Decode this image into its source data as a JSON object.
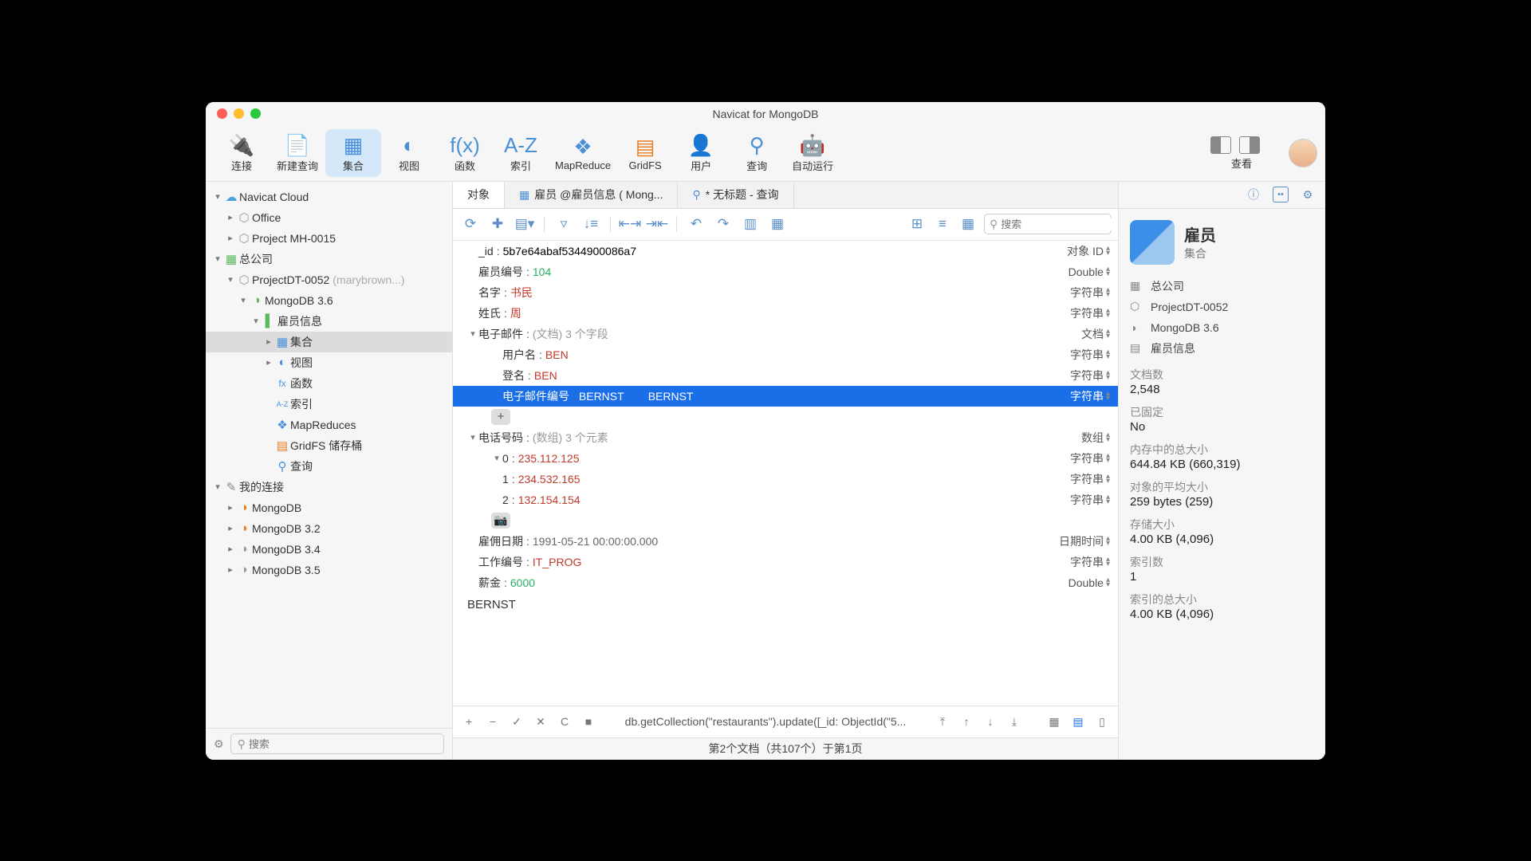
{
  "window": {
    "title": "Navicat for MongoDB"
  },
  "toolbar": {
    "items": [
      {
        "id": "connect",
        "label": "连接"
      },
      {
        "id": "newquery",
        "label": "新建查询"
      },
      {
        "id": "collection",
        "label": "集合",
        "active": true
      },
      {
        "id": "view",
        "label": "视图"
      },
      {
        "id": "function",
        "label": "函数"
      },
      {
        "id": "index",
        "label": "索引"
      },
      {
        "id": "mapreduce",
        "label": "MapReduce"
      },
      {
        "id": "gridfs",
        "label": "GridFS"
      },
      {
        "id": "user",
        "label": "用户"
      },
      {
        "id": "query",
        "label": "查询"
      },
      {
        "id": "autorun",
        "label": "自动运行"
      }
    ],
    "view_label": "查看"
  },
  "sidebar": {
    "search_placeholder": "搜索",
    "nodes": [
      {
        "pad": 8,
        "chev": "▾",
        "icon": "☁",
        "color": "#4aa3e0",
        "label": "Navicat Cloud"
      },
      {
        "pad": 24,
        "chev": "▸",
        "icon": "⬡",
        "color": "#999",
        "label": "Office"
      },
      {
        "pad": 24,
        "chev": "▸",
        "icon": "⬡",
        "color": "#999",
        "label": "Project MH-0015"
      },
      {
        "pad": 8,
        "chev": "▾",
        "icon": "▦",
        "color": "#5cb85c",
        "label": "总公司"
      },
      {
        "pad": 24,
        "chev": "▾",
        "icon": "⬡",
        "color": "#999",
        "label": "ProjectDT-0052",
        "hint": "(marybrown...)"
      },
      {
        "pad": 40,
        "chev": "▾",
        "icon": "◑",
        "color": "#5cb85c",
        "label": "MongoDB 3.6"
      },
      {
        "pad": 56,
        "chev": "▾",
        "icon": "▌",
        "color": "#5cb85c",
        "label": "雇员信息"
      },
      {
        "pad": 72,
        "chev": "▸",
        "icon": "▦",
        "color": "#4a90d9",
        "label": "集合",
        "sel": true
      },
      {
        "pad": 72,
        "chev": "▸",
        "icon": "◐",
        "color": "#4a90d9",
        "label": "视图"
      },
      {
        "pad": 72,
        "chev": "",
        "icon": "fx",
        "color": "#4a90d9",
        "label": "函数",
        "fs": "12px"
      },
      {
        "pad": 72,
        "chev": "",
        "icon": "A-Z",
        "color": "#4a90d9",
        "label": "索引",
        "fs": "9px"
      },
      {
        "pad": 72,
        "chev": "",
        "icon": "❖",
        "color": "#4a90d9",
        "label": "MapReduces"
      },
      {
        "pad": 72,
        "chev": "",
        "icon": "▤",
        "color": "#e67e22",
        "label": "GridFS 储存桶"
      },
      {
        "pad": 72,
        "chev": "",
        "icon": "⚲",
        "color": "#4a90d9",
        "label": "查询"
      },
      {
        "pad": 8,
        "chev": "▾",
        "icon": "✎",
        "color": "#888",
        "label": "我的连接"
      },
      {
        "pad": 24,
        "chev": "▸",
        "icon": "◑",
        "color": "#e67e22",
        "label": "MongoDB"
      },
      {
        "pad": 24,
        "chev": "▸",
        "icon": "◑",
        "color": "#e67e22",
        "label": "MongoDB 3.2"
      },
      {
        "pad": 24,
        "chev": "▸",
        "icon": "◑",
        "color": "#999",
        "label": "MongoDB 3.4"
      },
      {
        "pad": 24,
        "chev": "▸",
        "icon": "◑",
        "color": "#999",
        "label": "MongoDB 3.5"
      }
    ]
  },
  "tabs": [
    {
      "label": "对象",
      "active": true
    },
    {
      "label": "雇员 @雇员信息 ( Mong...",
      "icon": "▦"
    },
    {
      "label": "* 无标题 - 查询",
      "icon": "⚲"
    }
  ],
  "subbar": {
    "search_placeholder": "搜索"
  },
  "doc": {
    "rows": [
      {
        "pad": 18,
        "chev": "",
        "key": "_id",
        "val": "5b7e64abaf5344900086a7",
        "cls": "",
        "type": "对象 ID"
      },
      {
        "pad": 18,
        "chev": "",
        "key": "雇员编号",
        "val": "104",
        "cls": "num",
        "type": "Double"
      },
      {
        "pad": 18,
        "chev": "",
        "key": "名字",
        "val": "书民",
        "cls": "str",
        "type": "字符串"
      },
      {
        "pad": 18,
        "chev": "",
        "key": "姓氏",
        "val": "周",
        "cls": "str",
        "type": "字符串"
      },
      {
        "pad": 18,
        "chev": "▾",
        "key": "电子邮件",
        "val": "(文档) 3 个字段",
        "cls": "obj",
        "type": "文档"
      },
      {
        "pad": 48,
        "chev": "",
        "key": "用户名",
        "val": "BEN",
        "cls": "str",
        "type": "字符串"
      },
      {
        "pad": 48,
        "chev": "",
        "key": "登名",
        "val": "BEN",
        "cls": "str",
        "type": "字符串"
      },
      {
        "pad": 48,
        "chev": "",
        "key": "电子邮件编号",
        "val": "BERNST",
        "val2": "BERNST",
        "cls": "str",
        "type": "字符串",
        "sel": true
      },
      {
        "add": true
      },
      {
        "pad": 18,
        "chev": "▾",
        "key": "电话号码",
        "val": "(数组) 3 个元素",
        "cls": "obj",
        "type": "数组"
      },
      {
        "pad": 48,
        "chev": "▾",
        "key": "0",
        "val": "235.112.125",
        "cls": "str",
        "type": "字符串"
      },
      {
        "pad": 48,
        "chev": "",
        "key": "1",
        "val": "234.532.165",
        "cls": "str",
        "type": "字符串"
      },
      {
        "pad": 48,
        "chev": "",
        "key": "2",
        "val": "132.154.154",
        "cls": "str",
        "type": "字符串"
      },
      {
        "cam": true
      },
      {
        "pad": 18,
        "chev": "",
        "key": "雇佣日期",
        "val": "1991-05-21 00:00:00.000",
        "cls": "date",
        "type": "日期时间"
      },
      {
        "pad": 18,
        "chev": "",
        "key": "工作编号",
        "val": "IT_PROG",
        "cls": "str",
        "type": "字符串"
      },
      {
        "pad": 18,
        "chev": "",
        "key": "薪金",
        "val": "6000",
        "cls": "num",
        "type": "Double"
      }
    ],
    "edit_value": "BERNST"
  },
  "footer": {
    "cmd": "db.getCollection(\"restaurants\").update([_id: ObjectId(\"5...",
    "status": "第2个文档（共107个）于第1页"
  },
  "inspector": {
    "title": "雇员",
    "subtitle": "集合",
    "path": [
      {
        "icon": "▦",
        "label": "总公司"
      },
      {
        "icon": "⬡",
        "label": "ProjectDT-0052"
      },
      {
        "icon": "◑",
        "label": "MongoDB 3.6"
      },
      {
        "icon": "▤",
        "label": "雇员信息"
      }
    ],
    "stats": [
      {
        "k": "文档数",
        "v": "2,548"
      },
      {
        "k": "已固定",
        "v": "No"
      },
      {
        "k": "内存中的总大小",
        "v": "644.84 KB (660,319)"
      },
      {
        "k": "对象的平均大小",
        "v": "259 bytes (259)"
      },
      {
        "k": "存储大小",
        "v": "4.00 KB (4,096)"
      },
      {
        "k": "索引数",
        "v": "1"
      },
      {
        "k": "索引的总大小",
        "v": "4.00 KB (4,096)"
      }
    ]
  }
}
